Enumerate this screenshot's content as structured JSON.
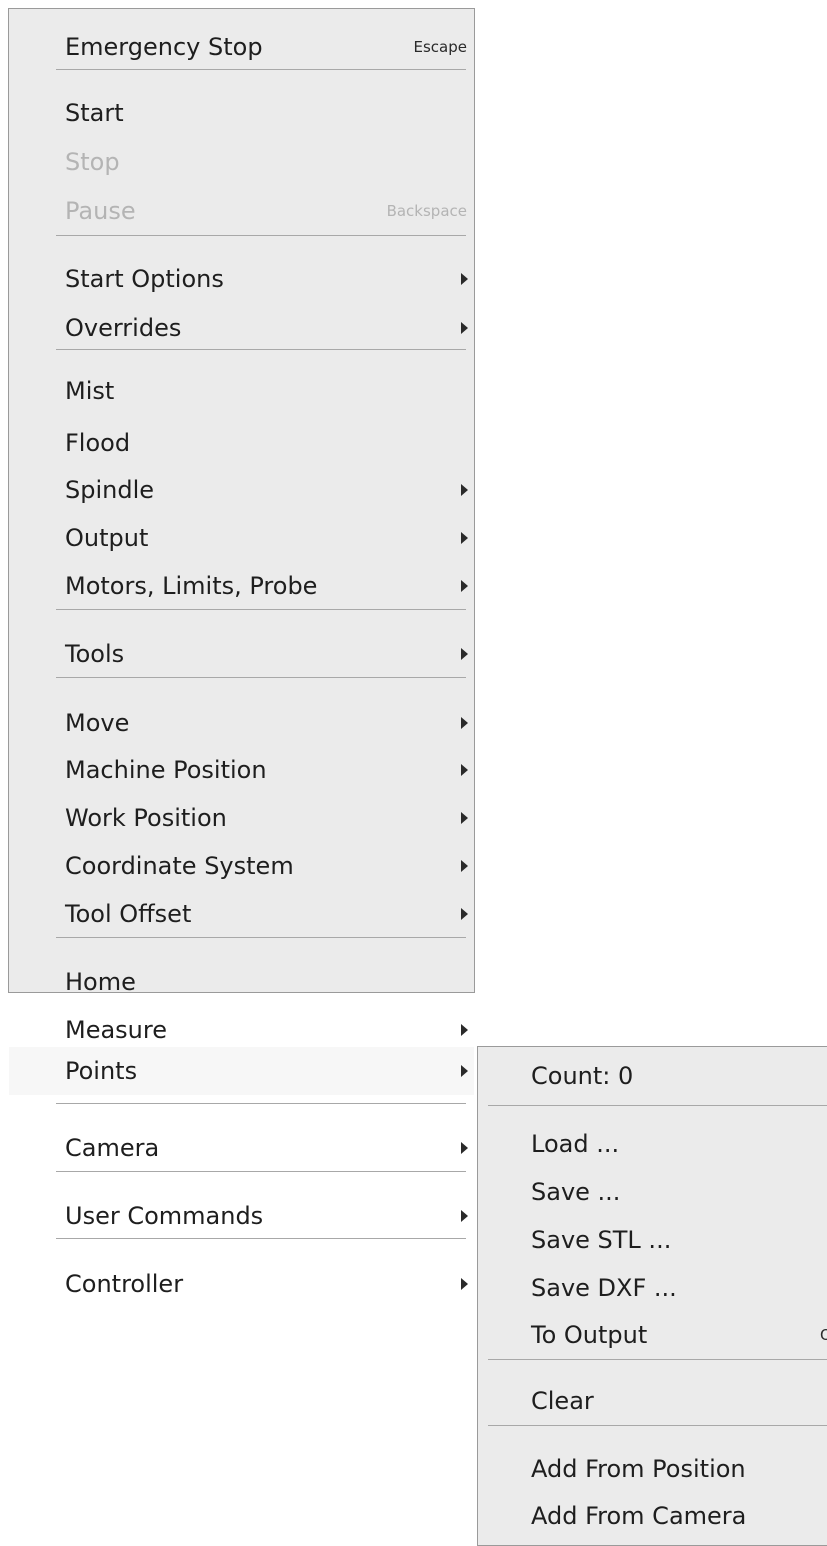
{
  "main_menu": {
    "emergency_stop": {
      "label": "Emergency Stop",
      "shortcut": "Escape"
    },
    "start": {
      "label": "Start"
    },
    "stop": {
      "label": "Stop"
    },
    "pause": {
      "label": "Pause",
      "shortcut": "Backspace"
    },
    "start_options": {
      "label": "Start Options"
    },
    "overrides": {
      "label": "Overrides"
    },
    "mist": {
      "label": "Mist"
    },
    "flood": {
      "label": "Flood"
    },
    "spindle": {
      "label": "Spindle"
    },
    "output": {
      "label": "Output"
    },
    "motors_limits_probe": {
      "label": "Motors, Limits, Probe"
    },
    "tools": {
      "label": "Tools"
    },
    "move": {
      "label": "Move"
    },
    "machine_position": {
      "label": "Machine Position"
    },
    "work_position": {
      "label": "Work Position"
    },
    "coordinate_system": {
      "label": "Coordinate System"
    },
    "tool_offset": {
      "label": "Tool Offset"
    },
    "home": {
      "label": "Home"
    },
    "measure": {
      "label": "Measure"
    },
    "points": {
      "label": "Points"
    },
    "camera": {
      "label": "Camera"
    },
    "user_commands": {
      "label": "User Commands"
    },
    "controller": {
      "label": "Controller"
    }
  },
  "points_submenu": {
    "count": {
      "label": "Count: 0"
    },
    "load": {
      "label": "Load ..."
    },
    "save": {
      "label": "Save ..."
    },
    "save_stl": {
      "label": "Save STL ..."
    },
    "save_dxf": {
      "label": "Save DXF ..."
    },
    "to_output": {
      "label": "To Output",
      "shortcut": "O"
    },
    "clear": {
      "label": "Clear"
    },
    "add_from_position": {
      "label": "Add From Position"
    },
    "add_from_camera": {
      "label": "Add From Camera"
    }
  }
}
